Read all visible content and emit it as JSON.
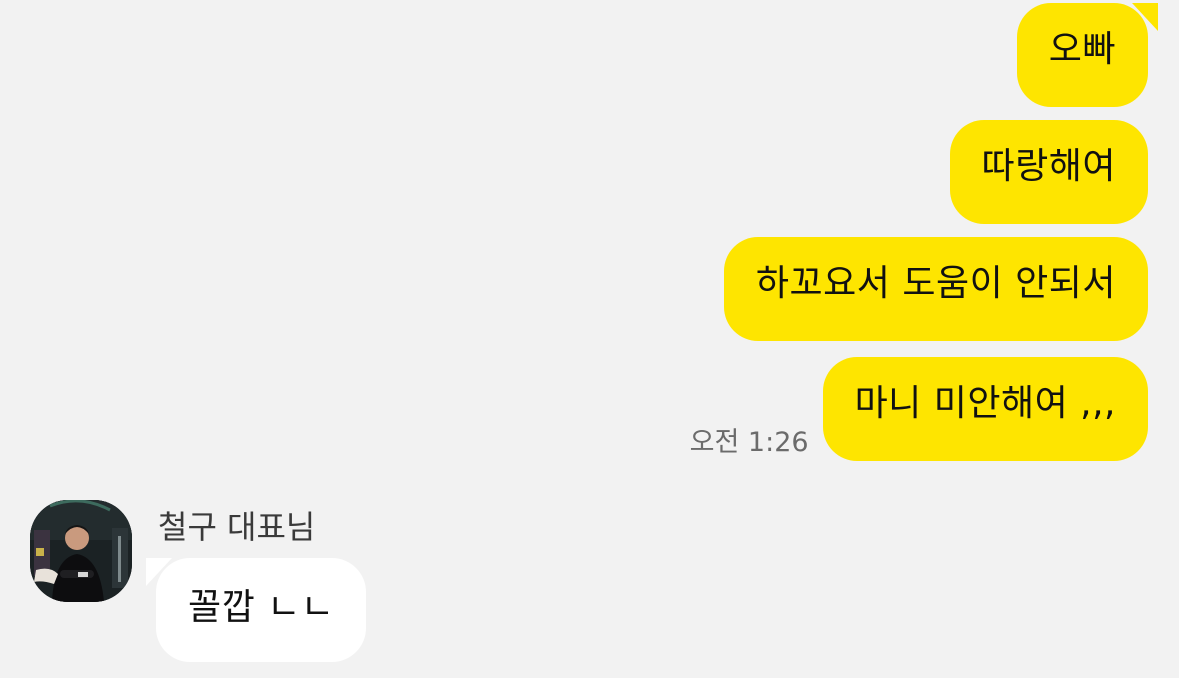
{
  "chat": {
    "outgoing": [
      {
        "text": "오빠"
      },
      {
        "text": "따랑해여"
      },
      {
        "text": "하꼬요서 도움이 안되서"
      },
      {
        "text": "마니 미안해여 ,,,",
        "time": "오전 1:26"
      }
    ],
    "incoming": {
      "sender": "철구 대표님",
      "text": "꼴깝 ㄴㄴ"
    }
  },
  "colors": {
    "background": "#f2f2f2",
    "outgoing_bubble": "#fee500",
    "incoming_bubble": "#ffffff",
    "timestamp": "#6b6b6b"
  },
  "icons": {
    "avatar": "profile-photo-avatar"
  }
}
